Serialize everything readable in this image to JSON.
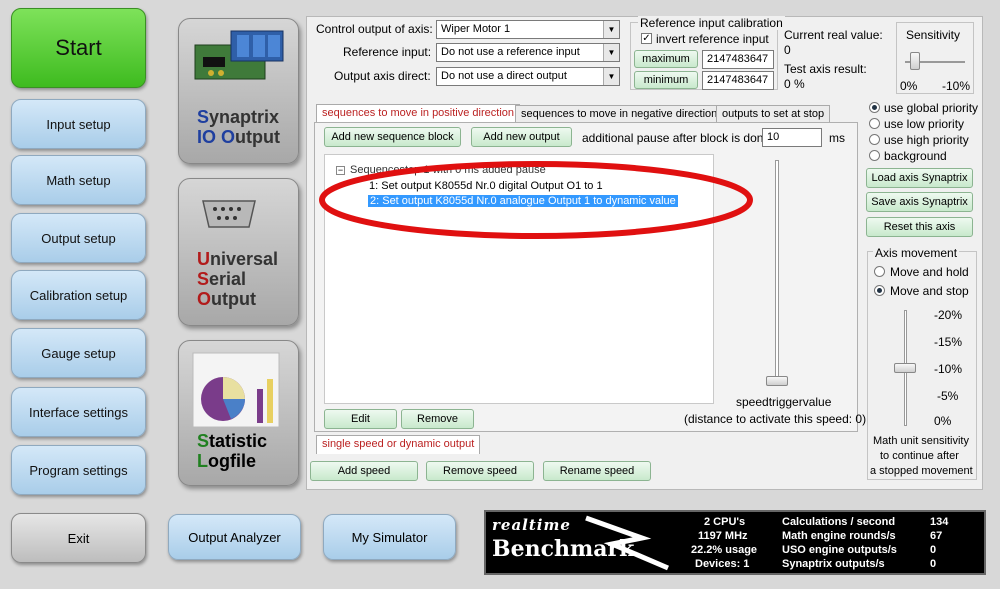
{
  "nav": {
    "start": "Start",
    "items": [
      "Input setup",
      "Math setup",
      "Output setup",
      "Calibration setup",
      "Gauge setup",
      "Interface settings",
      "Program settings"
    ],
    "exit": "Exit"
  },
  "bottom_buttons": {
    "output_analyzer": "Output Analyzer",
    "my_simulator": "My Simulator"
  },
  "modules": {
    "synaptrix": {
      "line1_first": "S",
      "line1_rest": "ynaptrix",
      "line2_first": "IO ",
      "line2_o": "O",
      "line2_rest": "utput"
    },
    "uso": {
      "line1_first": "U",
      "line1_rest": "niversal",
      "line2_first": "S",
      "line2_rest": "erial",
      "line3_first": "O",
      "line3_rest": "utput"
    },
    "statistic": {
      "line1_first": "S",
      "line1_rest": "tatistic",
      "line2_first": "L",
      "line2_rest": "ogfile"
    }
  },
  "control": {
    "axis_label": "Control output of axis:",
    "axis_value": "Wiper Motor 1",
    "ref_input_label": "Reference input:",
    "ref_input_value": "Do not use a reference input",
    "direct_label": "Output axis direct:",
    "direct_value": "Do not use a direct output"
  },
  "calibration": {
    "title": "Reference input calibration",
    "invert_label": "invert reference input",
    "invert_checked": true,
    "maximum_label": "maximum",
    "maximum_value": "2147483647",
    "minimum_label": "minimum",
    "minimum_value": "2147483647"
  },
  "status": {
    "current_real_label": "Current real value:",
    "current_real_value": "0",
    "test_axis_label": "Test axis result:",
    "test_axis_value": "0 %"
  },
  "sensitivity": {
    "label": "Sensitivity",
    "left": "0%",
    "right": "-10%"
  },
  "tabs": [
    "sequences to move in positive direction",
    "sequences to move in negative direction",
    "outputs to set at stop"
  ],
  "sequence": {
    "add_block": "Add new sequence block",
    "add_output": "Add new output",
    "pause_label": "additional pause after block is done:",
    "pause_value": "10",
    "pause_unit": "ms",
    "tree_root": "Sequencestep 1 with 0 ms added pause",
    "tree_items": [
      "1: Set output K8055d Nr.0 digital Output O1  to 1",
      "2: Set output K8055d Nr.0 analogue Output 1  to dynamic value"
    ],
    "speedtrigger_label": "speedtriggervalue",
    "edit": "Edit",
    "remove": "Remove",
    "distance_label": "(distance to activate this speed: 0)"
  },
  "speed_tab": "single speed or dynamic output",
  "speed_buttons": {
    "add": "Add speed",
    "remove": "Remove speed",
    "rename": "Rename speed"
  },
  "priority": {
    "options": [
      "use global priority",
      "use low priority",
      "use high priority",
      "background"
    ],
    "selected": 0
  },
  "axis_buttons": {
    "load": "Load axis Synaptrix",
    "save": "Save axis Synaptrix",
    "reset": "Reset this axis"
  },
  "axis_movement": {
    "title": "Axis movement",
    "options": [
      "Move and hold",
      "Move and stop"
    ],
    "selected": 1,
    "scale": [
      "-20%",
      "-15%",
      "-10%",
      "-5%",
      "0%"
    ],
    "note_line1": "Math unit sensitivity",
    "note_line2": "to continue after",
    "note_line3": "a stopped movement"
  },
  "benchmark": {
    "logo_top": "realtime",
    "logo_bottom": "Benchmark",
    "rows": [
      {
        "left": "2 CPU's",
        "label": "Calculations / second",
        "value": "134"
      },
      {
        "left": "1197 MHz",
        "label": "Math engine rounds/s",
        "value": "67"
      },
      {
        "left": "22.2% usage",
        "label": "USO engine outputs/s",
        "value": "0"
      },
      {
        "left": "Devices: 1",
        "label": "Synaptrix outputs/s",
        "value": "0"
      }
    ]
  },
  "colors": {
    "accent_blue": "#1f3f9f",
    "accent_red": "#b21b1b",
    "highlight_ellipse": "#e01010",
    "selection": "#3399ff"
  }
}
